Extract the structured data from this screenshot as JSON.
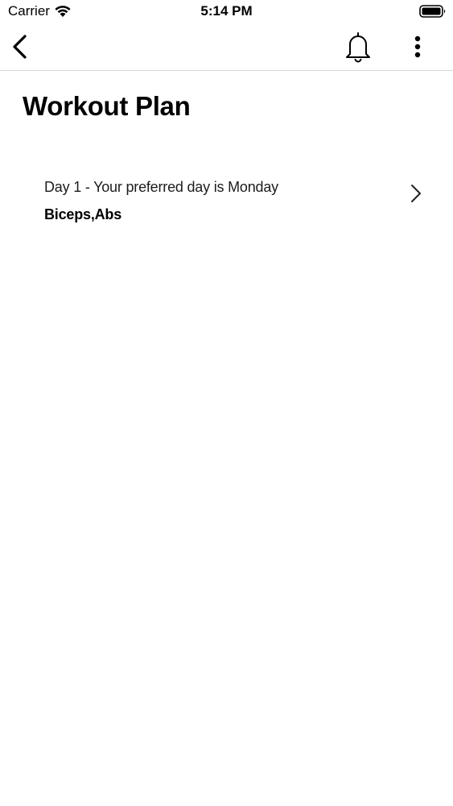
{
  "status_bar": {
    "carrier": "Carrier",
    "time": "5:14 PM"
  },
  "nav": {
    "back_icon": "chevron-left-icon",
    "notification_icon": "bell-icon",
    "more_icon": "more-vertical-icon"
  },
  "page": {
    "title": "Workout Plan"
  },
  "days": [
    {
      "subtitle": "Day 1 - Your preferred day is Monday",
      "muscles": "Biceps,Abs"
    }
  ],
  "colors": {
    "background": "#ffffff",
    "text": "#000000",
    "divider": "#d9d9d9"
  }
}
